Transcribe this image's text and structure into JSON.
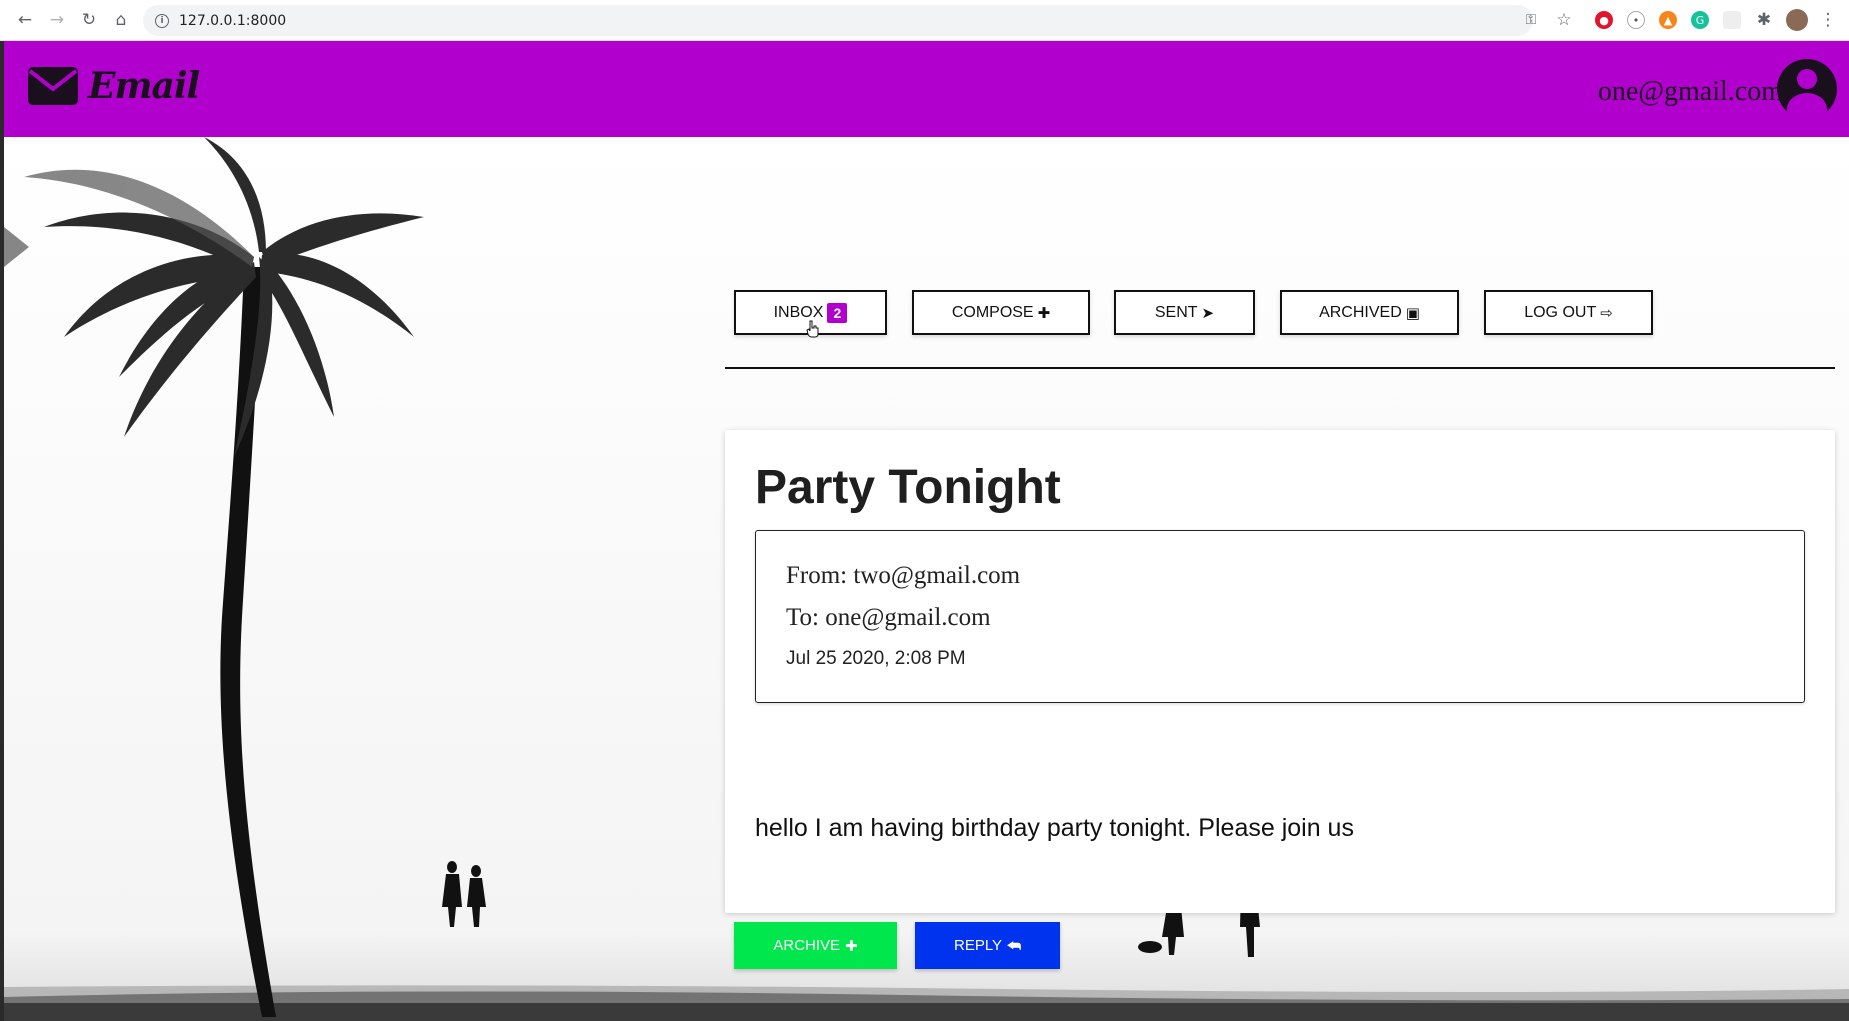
{
  "browser": {
    "url": "127.0.0.1:8000",
    "back_icon": "arrow-left-icon",
    "forward_icon": "arrow-right-icon",
    "reload_icon": "reload-icon",
    "home_icon": "home-icon"
  },
  "header": {
    "logo_text": "Email",
    "user_email": "one@gmail.com",
    "background_color": "#b100cd"
  },
  "nav": {
    "inbox_label": "INBOX",
    "inbox_count": "2",
    "compose_label": "COMPOSE",
    "sent_label": "SENT",
    "archived_label": "ARCHIVED",
    "logout_label": "LOG OUT"
  },
  "email": {
    "subject": "Party Tonight",
    "from": "From: two@gmail.com",
    "to": "To: one@gmail.com",
    "timestamp": "Jul 25 2020, 2:08 PM",
    "body": "hello I am having birthday party tonight. Please join us"
  },
  "actions": {
    "archive_label": "ARCHIVE",
    "archive_color": "#00e64d",
    "reply_label": "REPLY",
    "reply_color": "#0033ee"
  }
}
